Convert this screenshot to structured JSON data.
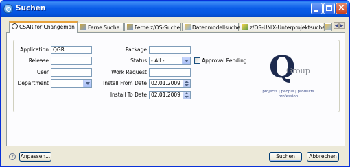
{
  "window": {
    "title": "Suchen",
    "accent": "#0a5ce8"
  },
  "tabs": [
    {
      "label": "CSAR for Changeman",
      "icon": "circle-c-icon",
      "active": true
    },
    {
      "label": "Ferne Suche",
      "icon": "remote-search-icon"
    },
    {
      "label": "Ferne z/OS-Suche",
      "icon": "remote-zos-search-icon"
    },
    {
      "label": "Datenmodellsuche",
      "icon": "datamodel-search-icon"
    },
    {
      "label": "z/OS-UNIX-Unterprojektsuche",
      "icon": "pencil-icon"
    }
  ],
  "form": {
    "application": {
      "label": "Application",
      "value": "QGR"
    },
    "release": {
      "label": "Release",
      "value": ""
    },
    "user": {
      "label": "User",
      "value": ""
    },
    "department": {
      "label": "Department",
      "value": ""
    },
    "package": {
      "label": "Package",
      "value": ""
    },
    "status": {
      "label": "Status",
      "value": "- All -"
    },
    "approval": {
      "label": "Approval Pending",
      "checked": false
    },
    "work_request": {
      "label": "Work Request",
      "value": ""
    },
    "install_from": {
      "label": "Install From Date",
      "value": "02.01.2009"
    },
    "install_to": {
      "label": "Install To Date",
      "value": "02.01.2009"
    }
  },
  "logo": {
    "letter": "Q",
    "word": "Group",
    "tagline1": "projects | people | products",
    "tagline2": "profession"
  },
  "footer": {
    "help": "?",
    "customize": "Anpassen...",
    "search": "Suchen",
    "cancel": "Abbrechen"
  }
}
